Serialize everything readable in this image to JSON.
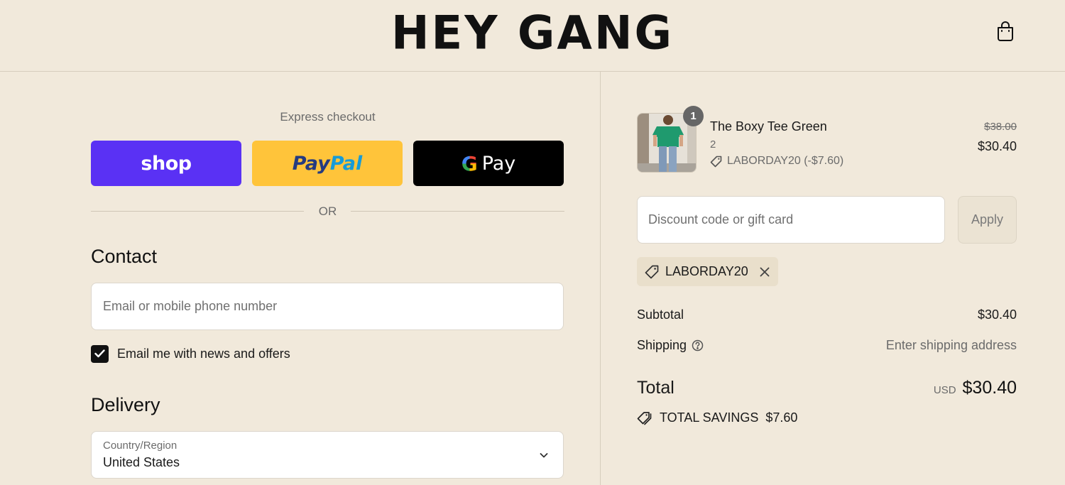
{
  "header": {
    "logo_text": "HEY GANG",
    "cart_icon": "shopping-bag-icon"
  },
  "express": {
    "label": "Express checkout",
    "shop_label": "shop",
    "paypal_label_1": "Pay",
    "paypal_label_2": "Pal",
    "gpay_g": "G",
    "gpay_label": "Pay",
    "or_label": "OR"
  },
  "contact": {
    "title": "Contact",
    "email_placeholder": "Email or mobile phone number",
    "newsletter_label": "Email me with news and offers",
    "newsletter_checked": true
  },
  "delivery": {
    "title": "Delivery",
    "country_label": "Country/Region",
    "country_value": "United States"
  },
  "order": {
    "item": {
      "name": "The Boxy Tee Green",
      "variant": "2",
      "quantity": "1",
      "discount": "LABORDAY20 (-$7.60)",
      "original_price": "$38.00",
      "price": "$30.40"
    },
    "discount_placeholder": "Discount code or gift card",
    "apply_label": "Apply",
    "applied_code": "LABORDAY20",
    "subtotal_label": "Subtotal",
    "subtotal_value": "$30.40",
    "shipping_label": "Shipping",
    "shipping_value": "Enter shipping address",
    "total_label": "Total",
    "currency": "USD",
    "total_value": "$30.40",
    "savings_label": "TOTAL SAVINGS",
    "savings_value": "$7.60"
  },
  "colors": {
    "background": "#f1e9db",
    "shop_purple": "#5a31f4",
    "paypal_yellow": "#ffc43a",
    "gpay_black": "#000000"
  }
}
